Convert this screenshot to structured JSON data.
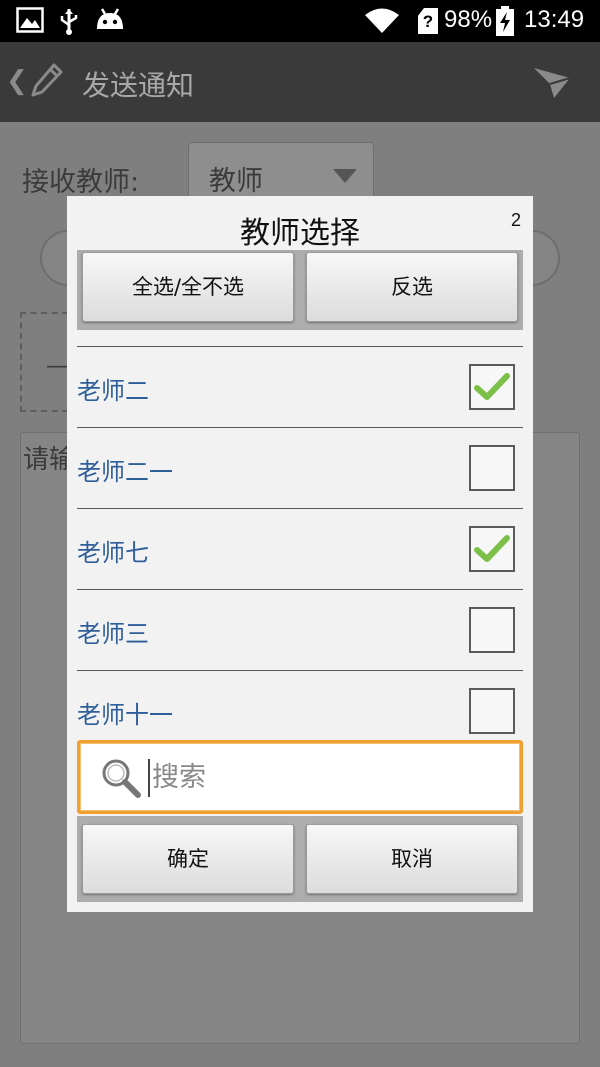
{
  "status_bar": {
    "battery": "98%",
    "time": "13:49",
    "sim_badge": "?"
  },
  "app_bar": {
    "back_glyph": "❮",
    "title": "发送通知"
  },
  "form": {
    "receiver_label": "接收教师:",
    "receiver_value": "教师",
    "dash_mark": "—",
    "content_placeholder": "请输"
  },
  "dialog": {
    "title": "教师选择",
    "selected_count": "2",
    "select_all_label": "全选/全不选",
    "invert_label": "反选",
    "teachers": [
      {
        "name": "老师二",
        "checked": true
      },
      {
        "name": "老师二一",
        "checked": false
      },
      {
        "name": "老师七",
        "checked": true
      },
      {
        "name": "老师三",
        "checked": false
      },
      {
        "name": "老师十一",
        "checked": false
      }
    ],
    "search_placeholder": "搜索",
    "confirm_label": "确定",
    "cancel_label": "取消"
  },
  "colors": {
    "teacher_name": "#2f5f9a",
    "checkmark": "#7cc04a",
    "search_focus": "#f0a030"
  }
}
